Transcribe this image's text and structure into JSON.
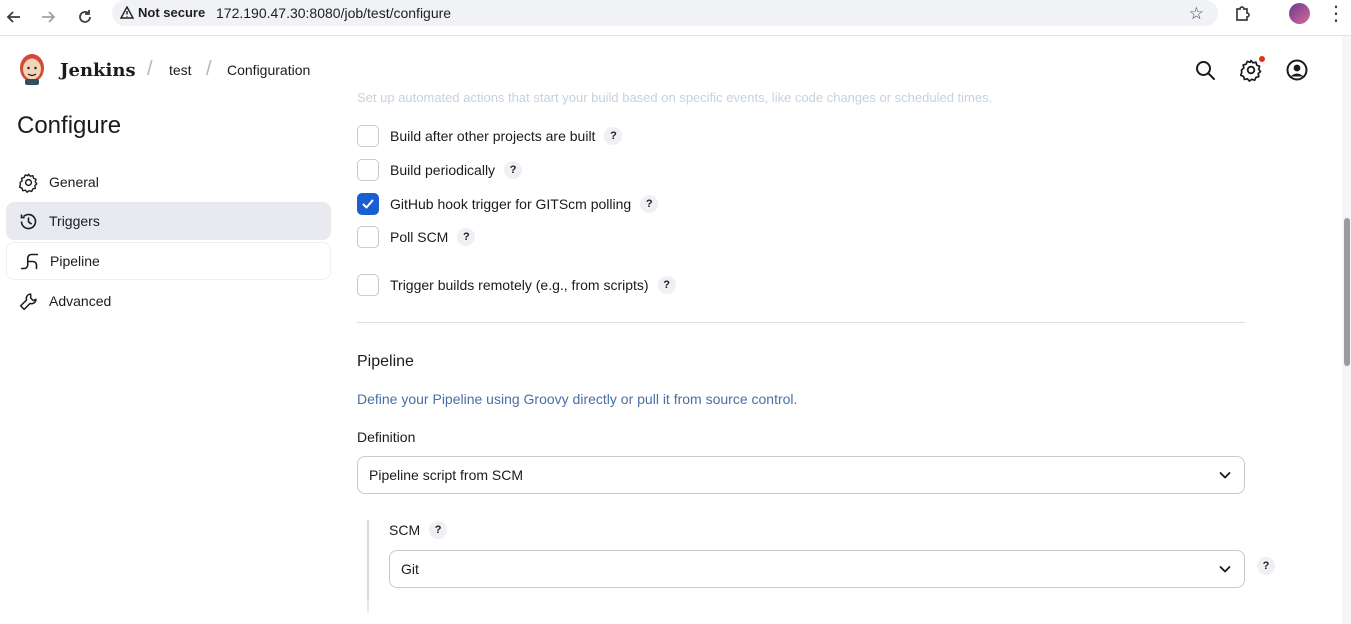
{
  "browser": {
    "security_label": "Not secure",
    "url": "172.190.47.30:8080/job/test/configure"
  },
  "header": {
    "brand": "Jenkins",
    "breadcrumbs": [
      "test",
      "Configuration"
    ],
    "faded_description": "Set up automated actions that start your build based on specific events, like code changes or scheduled times."
  },
  "sidebar": {
    "title": "Configure",
    "items": [
      {
        "label": "General",
        "icon": "gear-icon",
        "active": false
      },
      {
        "label": "Triggers",
        "icon": "clock-icon",
        "active": true
      },
      {
        "label": "Pipeline",
        "icon": "pipeline-icon",
        "active": false
      },
      {
        "label": "Advanced",
        "icon": "wrench-icon",
        "active": false
      }
    ]
  },
  "triggers": [
    {
      "label": "Build after other projects are built",
      "checked": false
    },
    {
      "label": "Build periodically",
      "checked": false
    },
    {
      "label": "GitHub hook trigger for GITScm polling",
      "checked": true
    },
    {
      "label": "Poll SCM",
      "checked": false
    },
    {
      "label": "Trigger builds remotely (e.g., from scripts)",
      "checked": false
    }
  ],
  "pipeline": {
    "title": "Pipeline",
    "description": "Define your Pipeline using Groovy directly or pull it from source control.",
    "definition_label": "Definition",
    "definition_value": "Pipeline script from SCM",
    "scm_label": "SCM",
    "scm_value": "Git"
  },
  "help_glyph": "?",
  "colors": {
    "accent": "#1a5fd1",
    "description": "#4a6fa5",
    "active_sidebar": "#e8eaef",
    "notification": "#e52f1d"
  }
}
